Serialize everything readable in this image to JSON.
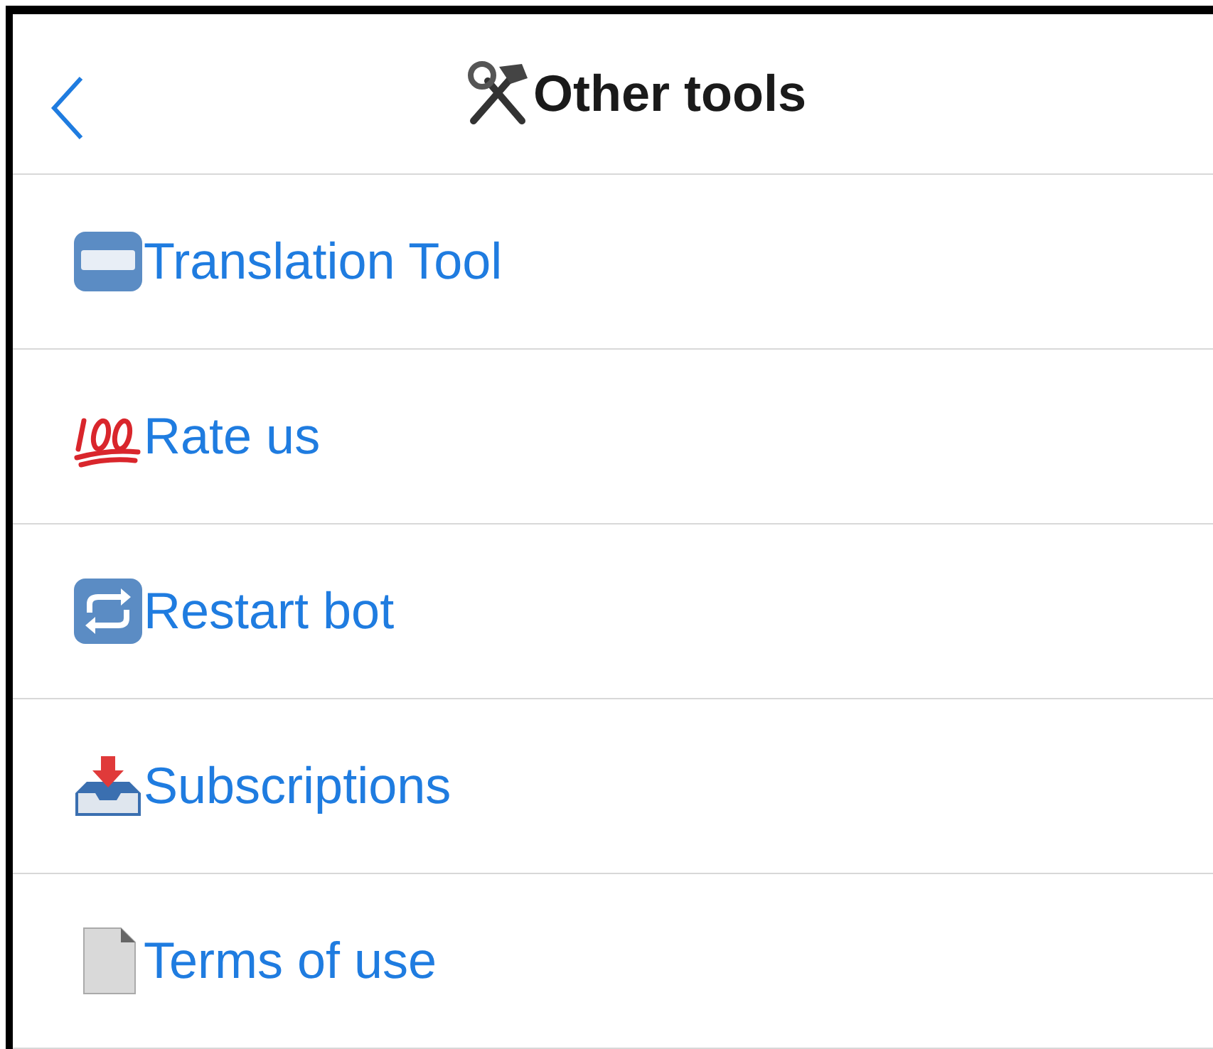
{
  "header": {
    "title": "Other tools"
  },
  "items": [
    {
      "kind": "translate",
      "label": "Translation Tool"
    },
    {
      "kind": "hundred",
      "label": "Rate us"
    },
    {
      "kind": "restart",
      "label": "Restart bot"
    },
    {
      "kind": "inbox",
      "label": "Subscriptions"
    },
    {
      "kind": "document",
      "label": "Terms of use"
    }
  ]
}
